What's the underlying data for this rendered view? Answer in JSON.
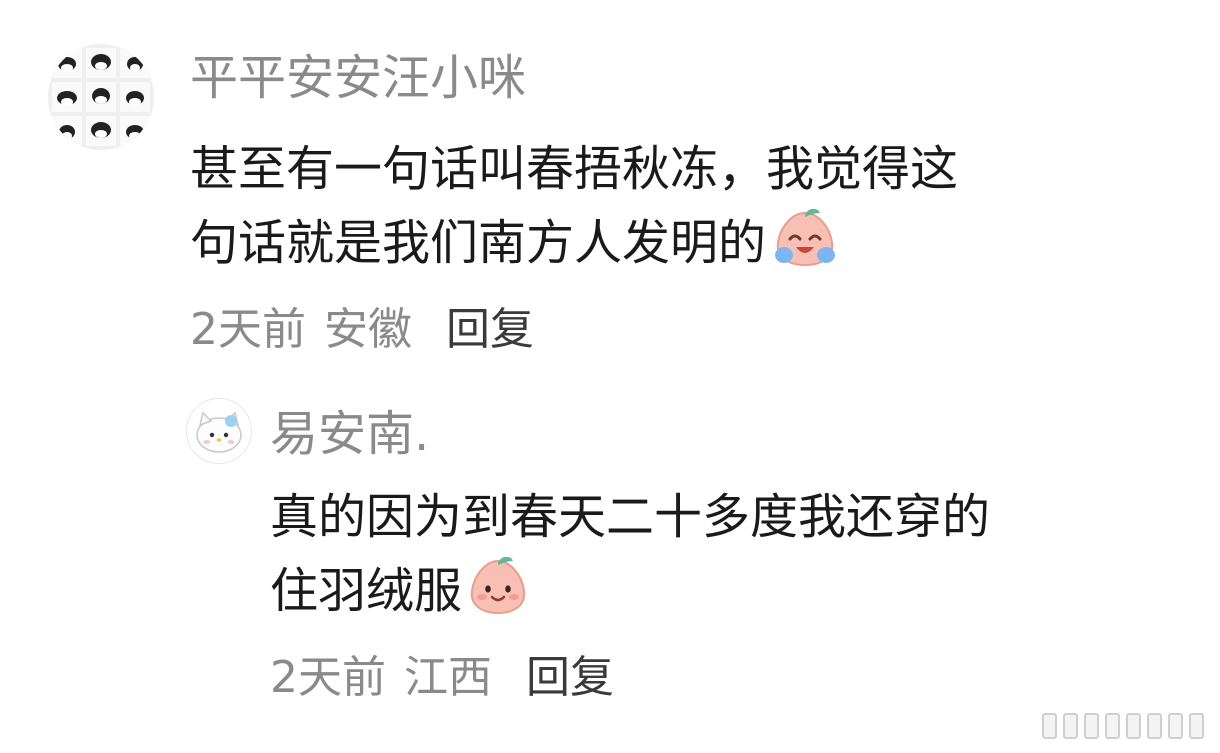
{
  "comments": [
    {
      "username": "平平安安汪小咪",
      "line1": "甚至有一句话叫春捂秋冻，我觉得这",
      "line2": "句话就是我们南方人发明的",
      "emoji": "laugh-cry-peach-emoji",
      "time": "2天前",
      "location": "安徽",
      "reply_label": "回复",
      "avatar_icon": "cat-collage-avatar"
    },
    {
      "username": "易安南.",
      "line1": "真的因为到春天二十多度我还穿的",
      "line2": "住羽绒服",
      "emoji": "smile-peach-emoji",
      "time": "2天前",
      "location": "江西",
      "reply_label": "回复",
      "avatar_icon": "hello-kitty-avatar"
    }
  ],
  "colors": {
    "meta_gray": "#8a8a8a",
    "text_dark": "#1a1a1a",
    "reply_dark": "#3a3a3a",
    "peach_pink": "#f7b9ae",
    "leaf_green": "#5fb89a"
  }
}
